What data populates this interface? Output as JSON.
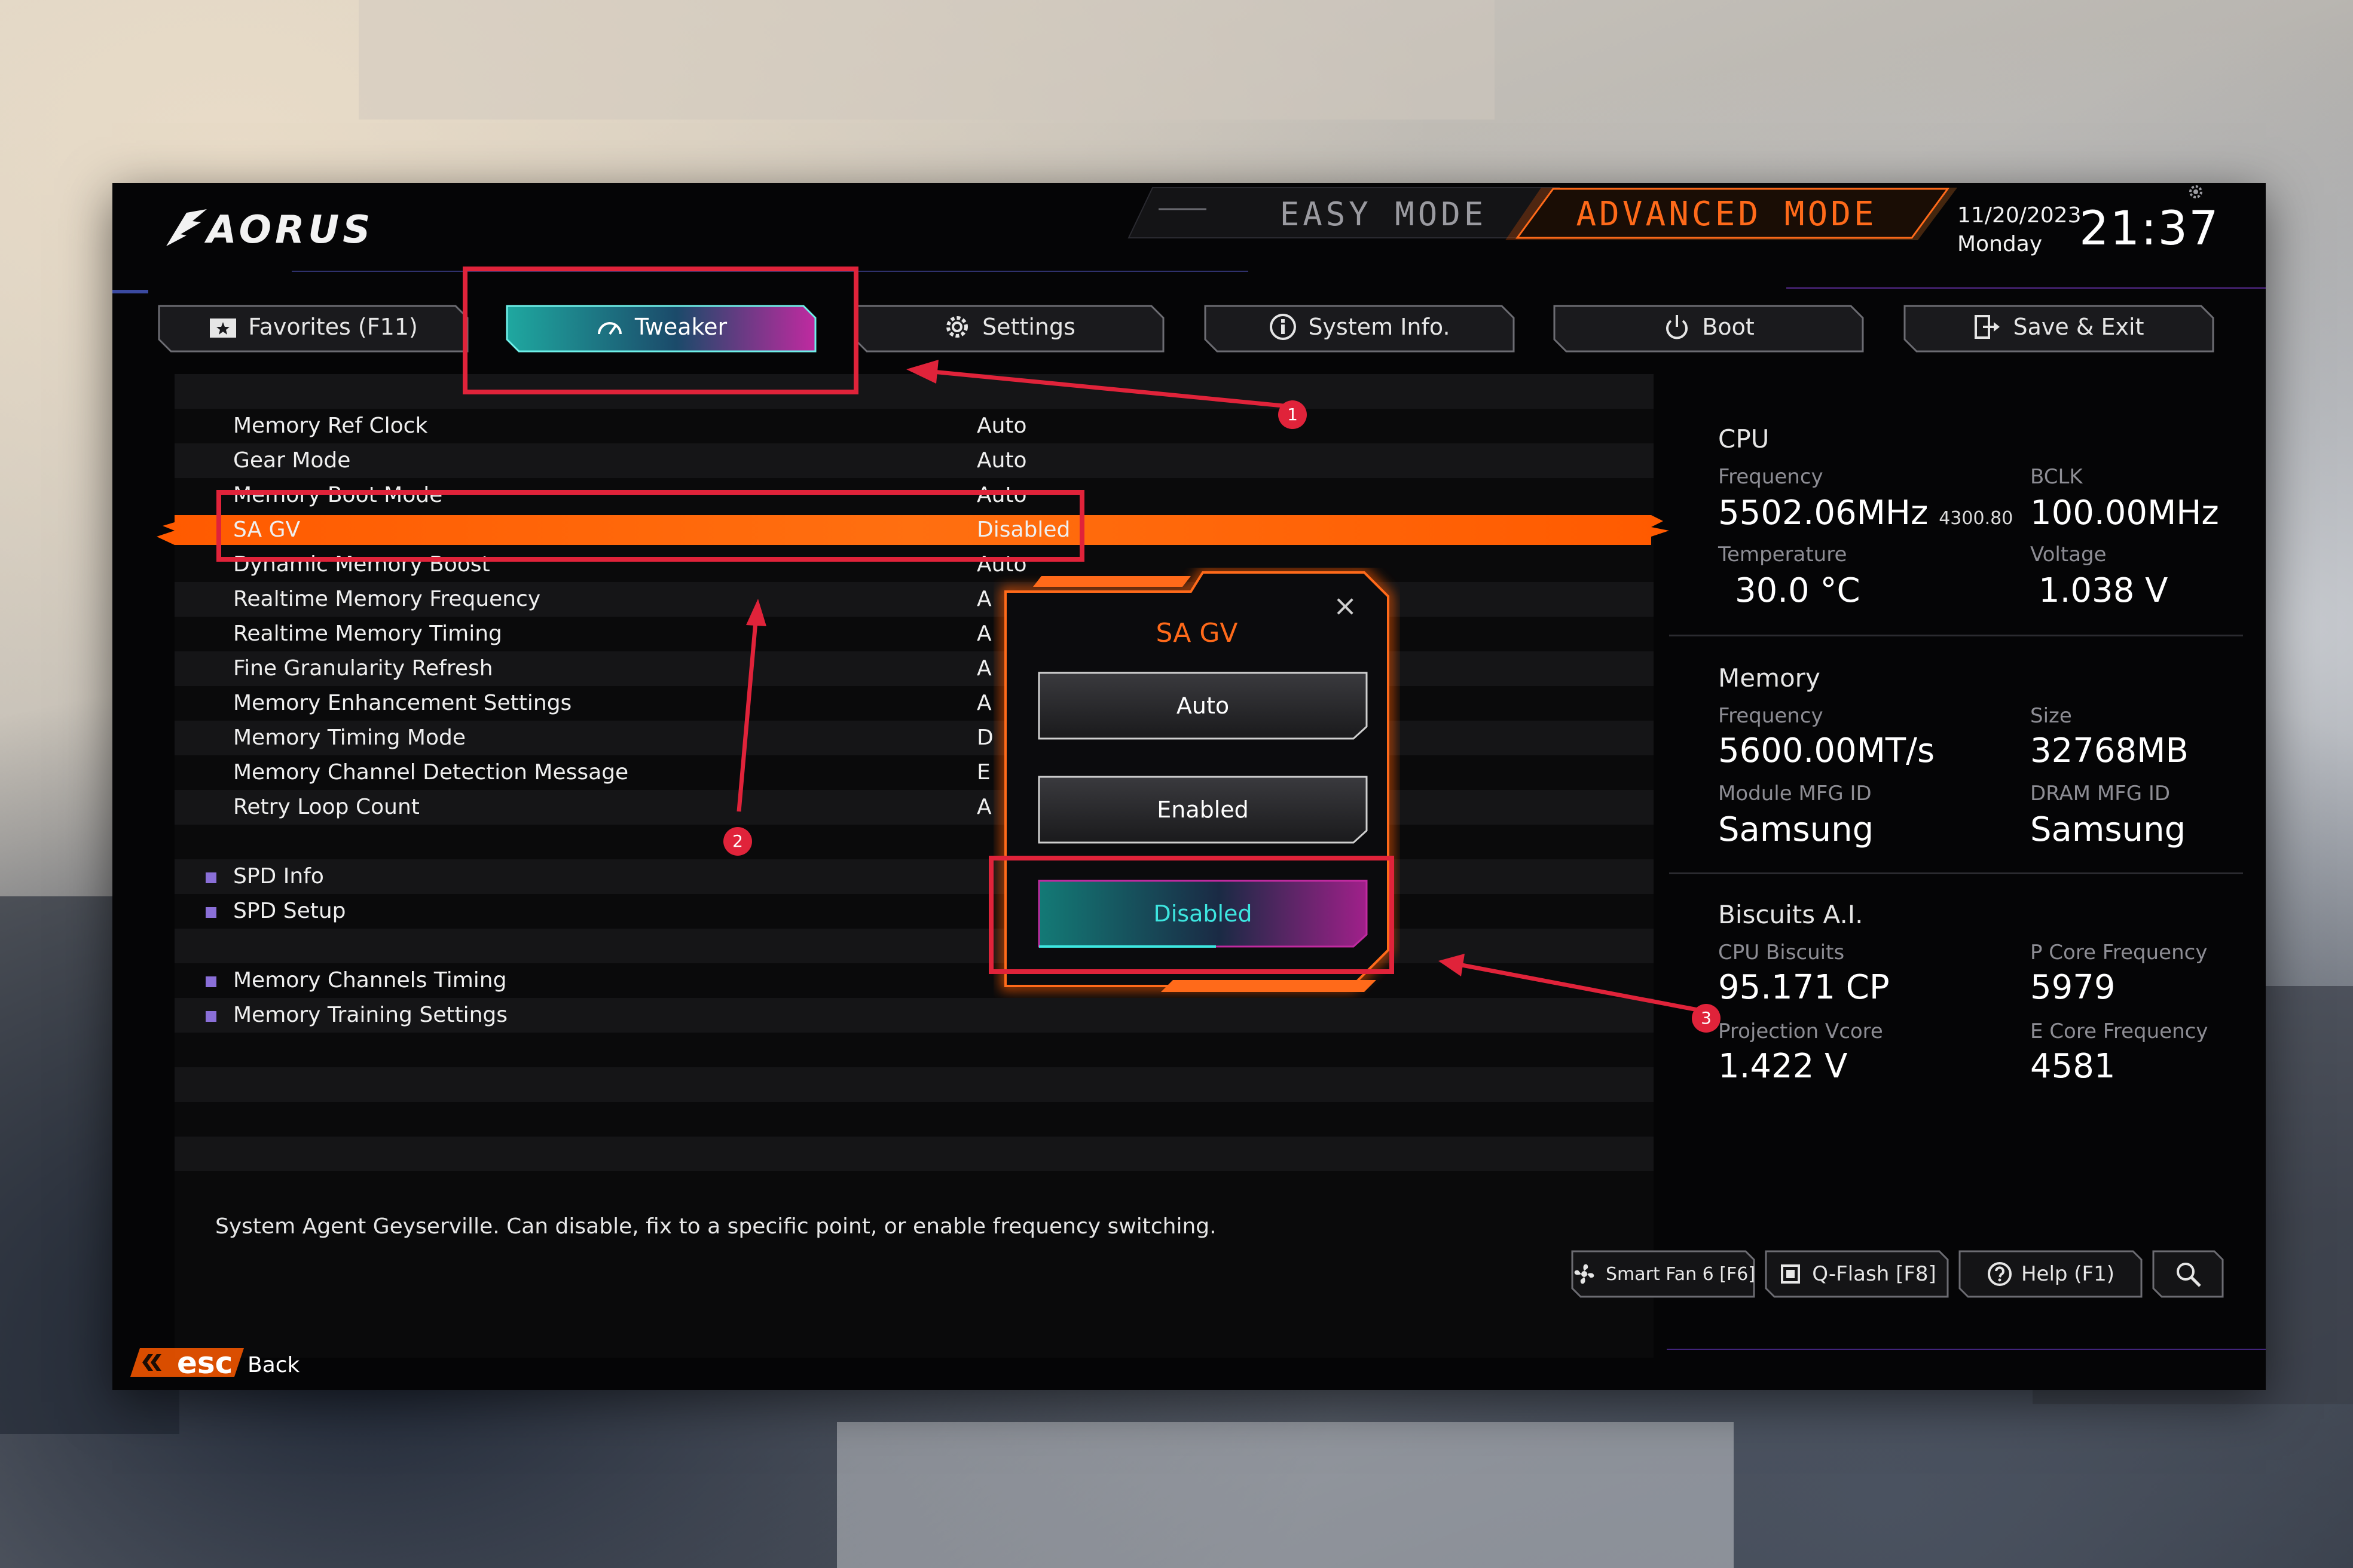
{
  "brand": "AORUS",
  "header": {
    "easy_mode": "EASY MODE",
    "advanced_mode": "ADVANCED MODE",
    "date": "11/20/2023",
    "day": "Monday",
    "time": "21:37"
  },
  "tabs": [
    {
      "label": "Favorites (F11)",
      "icon": "star-folder-icon"
    },
    {
      "label": "Tweaker",
      "icon": "speedometer-icon",
      "active": true
    },
    {
      "label": "Settings",
      "icon": "gear-icon"
    },
    {
      "label": "System Info.",
      "icon": "info-icon"
    },
    {
      "label": "Boot",
      "icon": "power-icon"
    },
    {
      "label": "Save & Exit",
      "icon": "exit-icon"
    }
  ],
  "settings": [
    {
      "label": "Memory Ref Clock",
      "value": "Auto"
    },
    {
      "label": "Gear Mode",
      "value": "Auto"
    },
    {
      "label": "Memory Boot Mode",
      "value": "Auto"
    },
    {
      "label": "SA GV",
      "value": "Disabled",
      "selected": true
    },
    {
      "label": "Dynamic Memory Boost",
      "value": "Auto"
    },
    {
      "label": "Realtime Memory Frequency",
      "value": "A"
    },
    {
      "label": "Realtime Memory Timing",
      "value": "A"
    },
    {
      "label": "Fine Granularity Refresh",
      "value": "A"
    },
    {
      "label": "Memory Enhancement Settings",
      "value": "A"
    },
    {
      "label": "Memory Timing Mode",
      "value": "D"
    },
    {
      "label": "Memory Channel Detection Message",
      "value": "E"
    },
    {
      "label": "Retry Loop Count",
      "value": "A"
    }
  ],
  "submenus_a": [
    "SPD Info",
    "SPD Setup"
  ],
  "submenus_b": [
    "Memory Channels Timing",
    "Memory Training Settings"
  ],
  "help_text": "System Agent Geyserville. Can disable, fix to a specific point, or enable frequency switching.",
  "popup": {
    "title": "SA GV",
    "close": "×",
    "options": [
      "Auto",
      "Enabled",
      "Disabled"
    ],
    "selected": "Disabled"
  },
  "info": {
    "cpu": {
      "title": "CPU",
      "freq_label": "Frequency",
      "freq": "5502.06MHz",
      "freq_sub": "4300.80",
      "bclk_label": "BCLK",
      "bclk": "100.00MHz",
      "temp_label": "Temperature",
      "temp": "30.0 °C",
      "volt_label": "Voltage",
      "volt": "1.038 V"
    },
    "memory": {
      "title": "Memory",
      "freq_label": "Frequency",
      "freq": "5600.00MT/s",
      "size_label": "Size",
      "size": "32768MB",
      "module_label": "Module MFG ID",
      "module": "Samsung",
      "dram_label": "DRAM MFG ID",
      "dram": "Samsung"
    },
    "biscuits": {
      "title": "Biscuits A.I.",
      "cpu_label": "CPU Biscuits",
      "cpu": "95.171 CP",
      "pcore_label": "P Core Frequency",
      "pcore": "5979",
      "vcore_label": "Projection Vcore",
      "vcore": "1.422 V",
      "ecore_label": "E Core Frequency",
      "ecore": "4581"
    }
  },
  "bottom": {
    "smart_fan": "Smart Fan 6 [F6]",
    "qflash": "Q-Flash [F8]",
    "help": "Help (F1)",
    "search_icon": "search-icon",
    "esc": "esc",
    "back": "Back"
  },
  "annotations": [
    "1",
    "2",
    "3"
  ],
  "colors": {
    "accent_orange": "#ff6a1a",
    "tab_active_teal": "#1fa8a0",
    "tab_active_magenta": "#c02aa0",
    "annotation_red": "#e0233a"
  }
}
